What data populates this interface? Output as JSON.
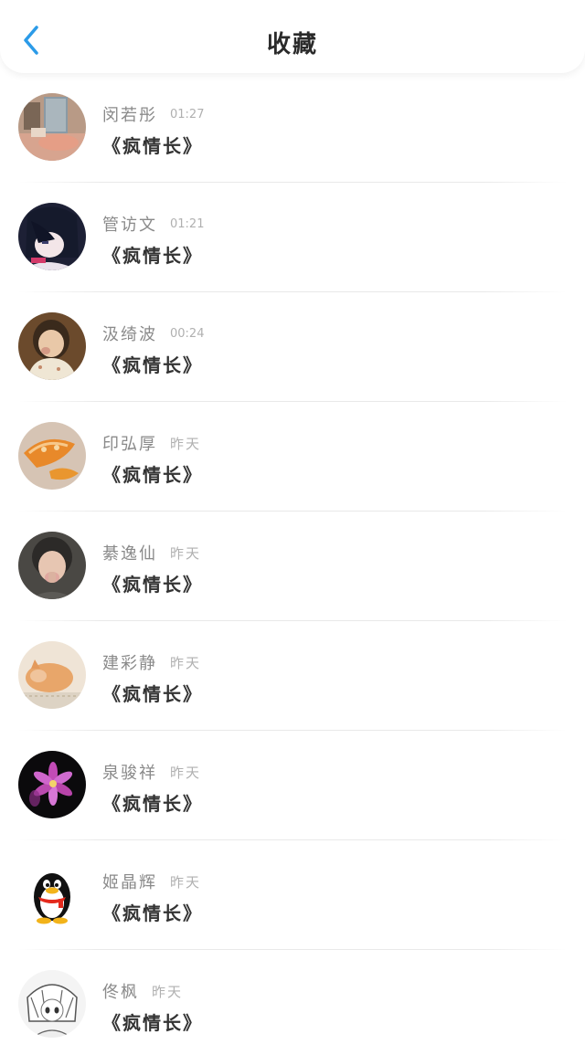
{
  "header": {
    "title": "收藏",
    "back_icon": "chevron-left-icon",
    "accent": "#2b9be8"
  },
  "favorites": [
    {
      "name": "闵若彤",
      "time": "01:27",
      "song": "《疯情长》"
    },
    {
      "name": "管访文",
      "time": "01:21",
      "song": "《疯情长》"
    },
    {
      "name": "汲绮波",
      "time": "00:24",
      "song": "《疯情长》"
    },
    {
      "name": "印弘厚",
      "time": "昨天",
      "song": "《疯情长》"
    },
    {
      "name": "綦逸仙",
      "time": "昨天",
      "song": "《疯情长》"
    },
    {
      "name": "建彩静",
      "time": "昨天",
      "song": "《疯情长》"
    },
    {
      "name": "泉骏祥",
      "time": "昨天",
      "song": "《疯情长》"
    },
    {
      "name": "姬晶辉",
      "time": "昨天",
      "song": "《疯情长》"
    },
    {
      "name": "佟枫",
      "time": "昨天",
      "song": "《疯情长》"
    }
  ]
}
